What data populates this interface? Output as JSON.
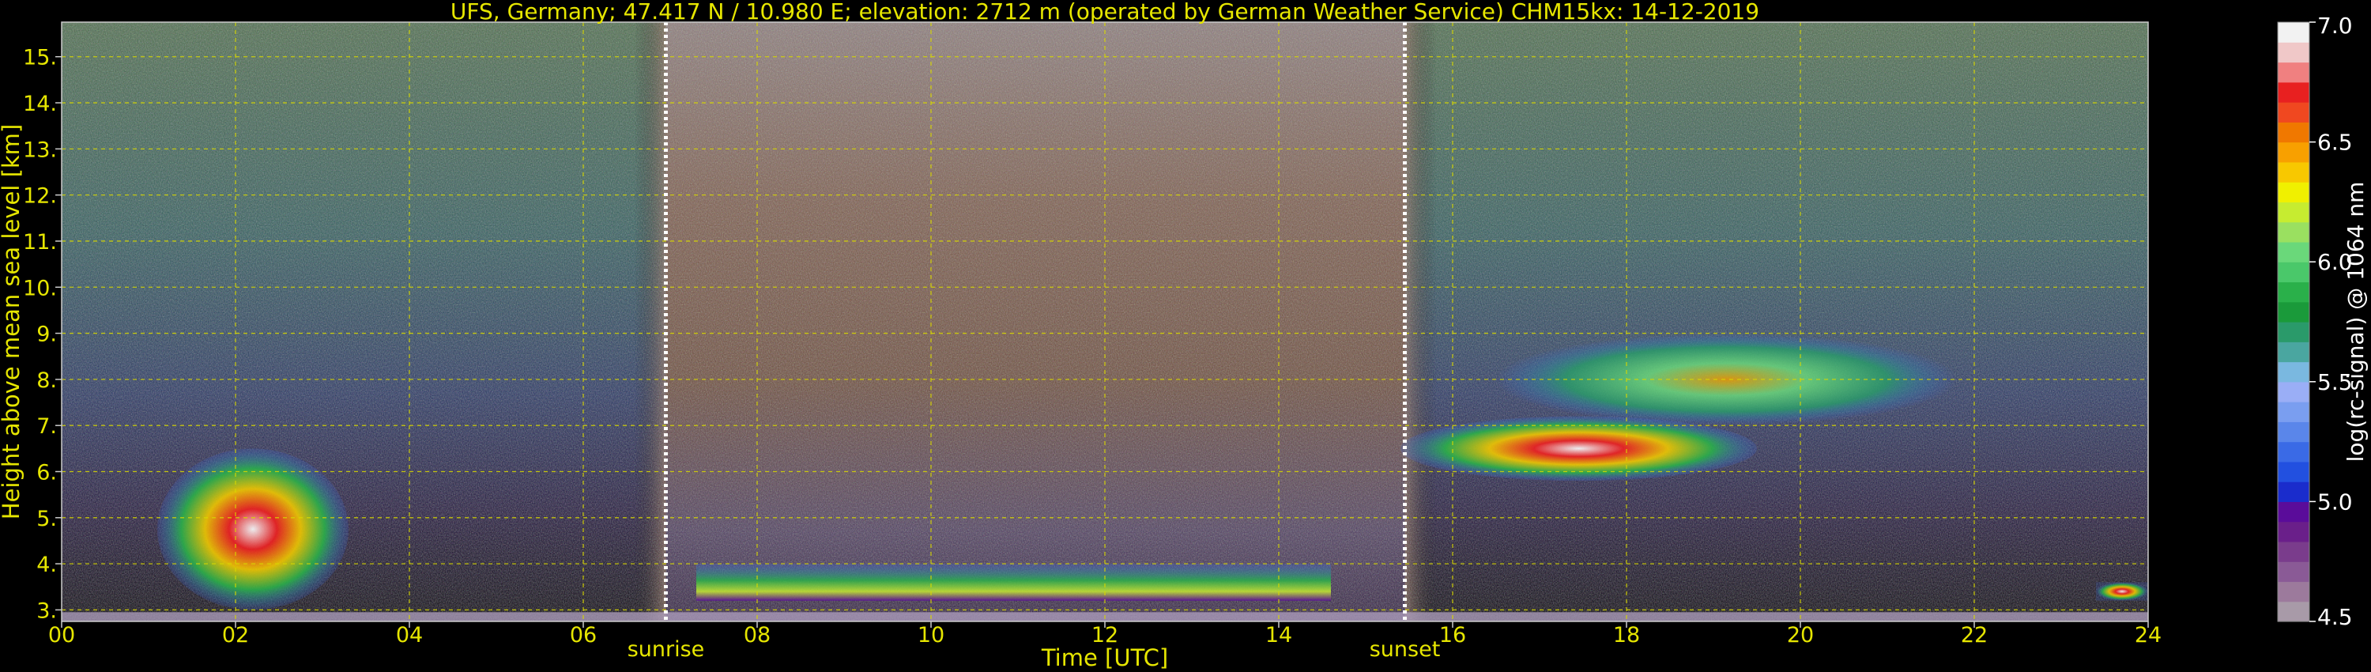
{
  "chart_data": {
    "type": "heatmap",
    "title": "UFS, Germany; 47.417 N / 10.980 E; elevation: 2712 m  (operated by German Weather Service)    CHM15kx: 14-12-2019",
    "xlabel": "Time [UTC]",
    "ylabel": "Height above mean sea level [km]",
    "xlim": [
      0,
      24
    ],
    "ylim": [
      2.75,
      15.75
    ],
    "x_ticks": [
      0,
      2,
      4,
      6,
      8,
      10,
      12,
      14,
      16,
      18,
      20,
      22,
      24
    ],
    "x_tick_labels": [
      "00",
      "02",
      "04",
      "06",
      "08",
      "10",
      "12",
      "14",
      "16",
      "18",
      "20",
      "22",
      "24"
    ],
    "y_ticks": [
      3,
      4,
      5,
      6,
      7,
      8,
      9,
      10,
      11,
      12,
      13,
      14,
      15
    ],
    "y_tick_labels": [
      "3.",
      "4.",
      "5.",
      "6.",
      "7.",
      "8.",
      "9.",
      "10.",
      "11.",
      "12.",
      "13.",
      "14.",
      "15."
    ],
    "grid": true,
    "annotations": [
      {
        "text": "sunrise",
        "x": 6.95
      },
      {
        "text": "sunset",
        "x": 15.45
      }
    ],
    "colorbar": {
      "label": "log(rc-signal) @ 1064 nm",
      "range": [
        4.5,
        7.0
      ],
      "ticks": [
        4.5,
        5.0,
        5.5,
        6.0,
        6.5,
        7.0
      ],
      "tick_labels": [
        "4.5",
        "5.0",
        "5.5",
        "6.0",
        "6.5",
        "7.0"
      ],
      "colors": [
        "#a89aa8",
        "#9c7a9c",
        "#8a5a96",
        "#7a3c8c",
        "#6a1f8a",
        "#5a0c9a",
        "#1a2ccc",
        "#2250e0",
        "#3a6ae6",
        "#5a86ea",
        "#7a9ef0",
        "#9aaef6",
        "#7ab8e0",
        "#4aa6a0",
        "#2a9a6a",
        "#1a9a3a",
        "#2ab04a",
        "#4ac86a",
        "#6ad87a",
        "#9ae060",
        "#c6ec30",
        "#f0f000",
        "#f8c800",
        "#f8a000",
        "#f07800",
        "#f04820",
        "#e82020",
        "#f08080",
        "#f0c8c8",
        "#f2f2f2"
      ]
    },
    "features": [
      {
        "name": "low cloud layer early morning",
        "t_start": 1.1,
        "t_end": 3.3,
        "h_top": 6.5,
        "h_bottom": 3.0
      },
      {
        "name": "boundary layer signal daytime",
        "t_start": 7.3,
        "t_end": 14.6,
        "h_top": 4.0,
        "h_bottom": 3.2
      },
      {
        "name": "cloud layer evening",
        "t_start": 15.4,
        "t_end": 19.5,
        "h_top": 7.2,
        "h_bottom": 5.8
      },
      {
        "name": "cirrus evening",
        "t_start": 16.5,
        "t_end": 21.8,
        "h_top": 9.0,
        "h_bottom": 7.0
      },
      {
        "name": "low cloud late night",
        "t_start": 23.4,
        "t_end": 24.0,
        "h_top": 3.6,
        "h_bottom": 3.2
      }
    ]
  }
}
